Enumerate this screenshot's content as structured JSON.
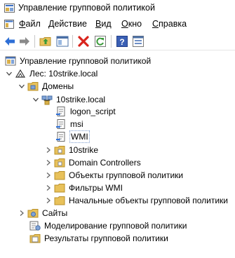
{
  "window": {
    "title": "Управление групповой политикой",
    "icon": "gpmc-app-icon"
  },
  "menu": {
    "items": [
      {
        "label": "Файл",
        "hotkey": "Ф",
        "rest": "айл"
      },
      {
        "label": "Действие",
        "hotkey": "Д",
        "rest": "ействие"
      },
      {
        "label": "Вид",
        "hotkey": "В",
        "rest": "ид"
      },
      {
        "label": "Окно",
        "hotkey": "О",
        "rest": "кно"
      },
      {
        "label": "Справка",
        "hotkey": "С",
        "rest": "правка"
      }
    ]
  },
  "toolbar": {
    "buttons": [
      {
        "name": "back-arrow-icon"
      },
      {
        "name": "forward-arrow-icon"
      },
      {
        "name": "up-folder-icon"
      },
      {
        "name": "show-hide-console-tree-icon"
      },
      {
        "name": "delete-icon"
      },
      {
        "name": "refresh-icon"
      },
      {
        "name": "help-icon"
      },
      {
        "name": "properties-icon"
      }
    ]
  },
  "tree": {
    "root": "Управление групповой политикой",
    "forest": "Лес: 10strike.local",
    "domains": "Домены",
    "domain": "10strike.local",
    "gpo_links": [
      "logon_script",
      "msi",
      "WMI"
    ],
    "ous": [
      "10strike",
      "Domain Controllers"
    ],
    "containers": [
      "Объекты групповой политики",
      "Фильтры WMI",
      "Начальные объекты групповой политики"
    ],
    "sites": "Сайты",
    "modeling": "Моделирование групповой политики",
    "results": "Результаты групповой политики",
    "selected": "WMI"
  },
  "colors": {
    "folder": "#e8c15a",
    "arrow_blue": "#2e6fd6",
    "arrow_green": "#3a9a3a",
    "delete_red": "#d9241c",
    "selection_outline": "#7a9acc"
  }
}
